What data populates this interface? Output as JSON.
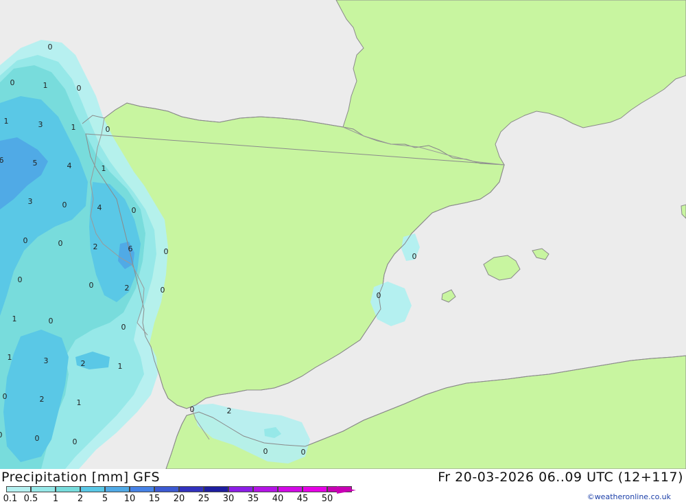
{
  "header": {
    "title": "Precipitation [mm] GFS",
    "datetime": "Fr 20-03-2026 06..09 UTC (12+117)"
  },
  "credit": "©weatheronline.co.uk",
  "legend": {
    "colors": [
      "#b4f0f0",
      "#96e8e8",
      "#78dcdc",
      "#5ac8e6",
      "#50aae6",
      "#4682e6",
      "#3c5ad2",
      "#3232be",
      "#1e1ea0",
      "#8c1ee6",
      "#b414e6",
      "#d20ae6",
      "#e600e6",
      "#c800b4"
    ],
    "labels": [
      "0.1",
      "0.5",
      "1",
      "2",
      "5",
      "10",
      "15",
      "20",
      "25",
      "30",
      "35",
      "40",
      "45",
      "50"
    ]
  },
  "map": {
    "colors": {
      "sea": "#ececec",
      "land": "#c8f5a0",
      "border": "#999999",
      "coast": "#8a8a8a"
    },
    "values": [
      {
        "t": "0"
      },
      {
        "t": "0"
      },
      {
        "t": "1"
      },
      {
        "t": "0"
      },
      {
        "t": "1"
      },
      {
        "t": "3"
      },
      {
        "t": "1"
      },
      {
        "t": "0"
      },
      {
        "t": "6"
      },
      {
        "t": "5"
      },
      {
        "t": "4"
      },
      {
        "t": "1"
      },
      {
        "t": "3"
      },
      {
        "t": "0"
      },
      {
        "t": "4"
      },
      {
        "t": "0"
      },
      {
        "t": "0"
      },
      {
        "t": "0"
      },
      {
        "t": "2"
      },
      {
        "t": "6"
      },
      {
        "t": "0"
      },
      {
        "t": "0"
      },
      {
        "t": "0"
      },
      {
        "t": "2"
      },
      {
        "t": "0"
      },
      {
        "t": "1"
      },
      {
        "t": "0"
      },
      {
        "t": "0"
      },
      {
        "t": "1"
      },
      {
        "t": "3"
      },
      {
        "t": "2"
      },
      {
        "t": "1"
      },
      {
        "t": "0"
      },
      {
        "t": "2"
      },
      {
        "t": "1"
      },
      {
        "t": "0"
      },
      {
        "t": "2"
      },
      {
        "t": "0"
      },
      {
        "t": "0"
      },
      {
        "t": "0"
      },
      {
        "t": "0"
      },
      {
        "t": "0"
      },
      {
        "t": "0"
      },
      {
        "t": "0"
      }
    ]
  }
}
